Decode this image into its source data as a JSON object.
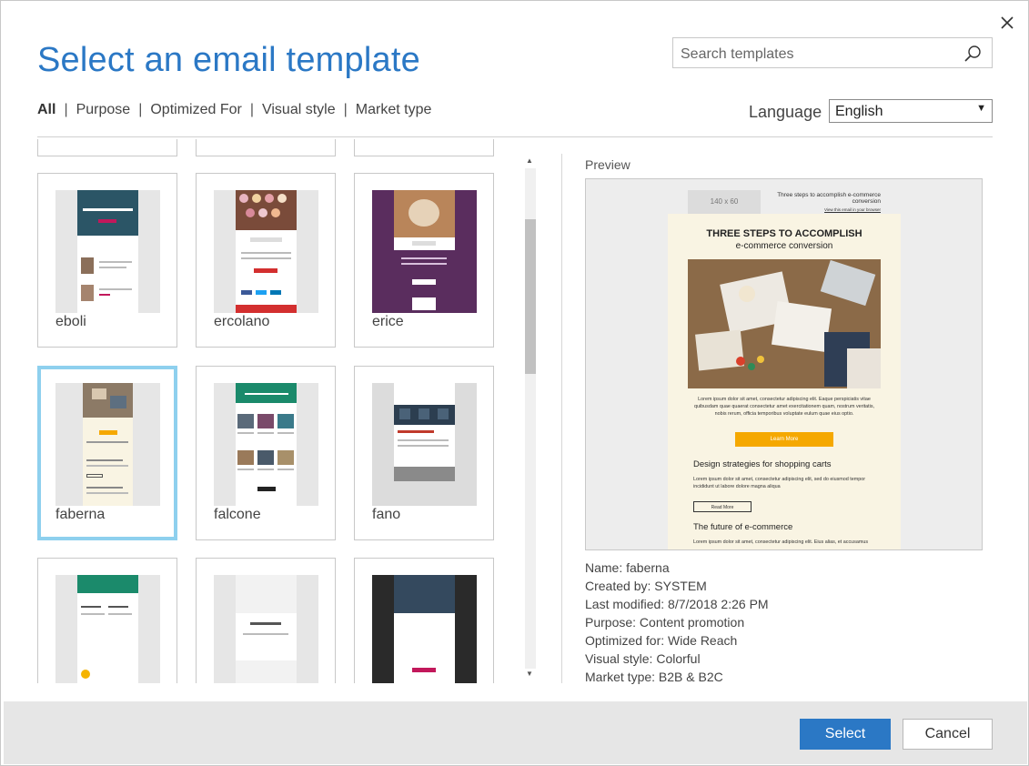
{
  "dialog": {
    "title": "Select an email template",
    "search": {
      "placeholder": "Search templates"
    }
  },
  "filters": [
    {
      "label": "All",
      "active": true
    },
    {
      "label": "Purpose"
    },
    {
      "label": "Optimized For"
    },
    {
      "label": "Visual style"
    },
    {
      "label": "Market type"
    }
  ],
  "filter_separator": "|",
  "language": {
    "label": "Language",
    "value": "English"
  },
  "templates": [
    {
      "name": "eboli"
    },
    {
      "name": "ercolano"
    },
    {
      "name": "erice"
    },
    {
      "name": "faberna",
      "selected": true
    },
    {
      "name": "falcone"
    },
    {
      "name": "fano"
    }
  ],
  "preview": {
    "label": "Preview",
    "logo_text": "140 x 60",
    "top_text": "Three steps to accomplish e-commerce conversion",
    "top_link": "View this email in your browser",
    "headline": "THREE STEPS TO ACCOMPLISH",
    "subheadline": "e-commerce conversion",
    "body": "Lorem ipsum dolor sit amet, consectetur adipiscing elit. Eaque perspiciatis vitae quibusdam quae quaerat consectetur amet exercitationem quam, nostrum veritatis, nobis rerum, officia temporibus voluptate eulum quae eius optio.",
    "cta": "Learn More",
    "section1_title": "Design strategies for shopping carts",
    "section1_text": "Lorem ipsum dolor sit amet, consectetur adipiscing elit, sed do eiusmod tempor incididunt ut labore dolore magna aliqua",
    "section1_button": "Read More",
    "section2_title": "The future of e-commerce",
    "section2_text": "Lorem ipsum dolor sit amet, consectetur adipiscing elit. Eius alias, et accusamus"
  },
  "details": {
    "name": "Name: faberna",
    "created_by": "Created by: SYSTEM",
    "last_modified": "Last modified: 8/7/2018 2:26 PM",
    "purpose": "Purpose: Content promotion",
    "optimized_for": "Optimized for: Wide Reach",
    "visual_style": "Visual style: Colorful",
    "market_type": "Market type: B2B & B2C"
  },
  "buttons": {
    "select": "Select",
    "cancel": "Cancel"
  },
  "colors": {
    "accent": "#2b78c5",
    "selected_border": "#8ed0ee",
    "cta": "#f5a800"
  },
  "icons": [
    "close-icon",
    "search-icon",
    "chevron-down-icon",
    "scroll-up-icon",
    "scroll-down-icon"
  ]
}
